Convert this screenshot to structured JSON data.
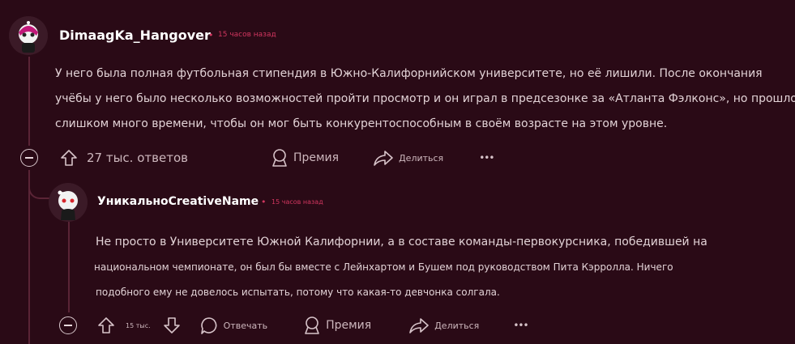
{
  "comment": {
    "username": "DimaagKa_Hangover",
    "dot": "•",
    "time": "15 часов назад",
    "lines": [
      "У него была полная футбольная стипендия в Южно-Калифорнийском университете, но её лишили. После окончания",
      "учёбы у него было несколько возможностей пройти просмотр и он играл в предсезонке за «Атланта Фэлконс», но прошло",
      "слишком много времени, чтобы он мог быть конкурентоспособным в своём возрасте на этом уровне."
    ],
    "actions": {
      "replies": "27 тыс. ответов",
      "premium": "Премия",
      "share": "Делиться",
      "more": "•••"
    }
  },
  "reply": {
    "username": "УникальноCreativeName",
    "dot": "•",
    "time": "15 часов назад",
    "lines": [
      "Не просто в Университете Южной Калифорнии, а в составе команды-первокурсника, победившей на",
      "национальном чемпионате, он был бы вместе с Лейнхартом и Бушем под руководством Пита Кэрролла. Ничего",
      "подобного ему не довелось испытать, потому что какая-то девчонка солгала."
    ],
    "actions": {
      "votes": "15 тыс.",
      "reply": "Отвечать",
      "premium": "Премия",
      "share": "Делиться",
      "more": "•••"
    }
  }
}
